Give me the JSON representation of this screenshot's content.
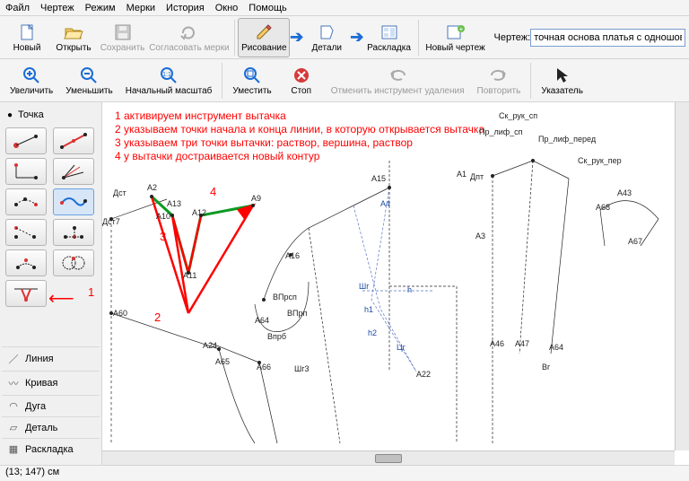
{
  "menu": {
    "file": "Файл",
    "drawing": "Чертеж",
    "mode": "Режим",
    "measures": "Мерки",
    "history": "История",
    "window": "Окно",
    "help": "Помощь"
  },
  "tb1": {
    "new": "Новый",
    "open": "Открыть",
    "save": "Сохранить",
    "sync": "Согласовать мерки",
    "draw": "Рисование",
    "detail": "Детали",
    "layout": "Раскладка",
    "newdraw": "Новый чертеж",
    "drawingLabel": "Чертеж:",
    "drawingValue": "точная основа платья с одношовным рука"
  },
  "tb2": {
    "zoomin": "Увеличить",
    "zoomout": "Уменьшить",
    "zoomreset": "Начальный масштаб",
    "fit": "Уместить",
    "stop": "Стоп",
    "undo": "Отменить инструмент удаления",
    "redo": "Повторить",
    "pointer": "Указатель"
  },
  "side": {
    "point": "Точка",
    "cat": {
      "line": "Линия",
      "curve": "Кривая",
      "arc": "Дуга",
      "detail": "Деталь",
      "layout": "Раскладка"
    },
    "redNum": "1"
  },
  "notes": {
    "l1": "1 активируем инструмент вытачка",
    "l2": "2 указываем точки начала и конца линии, в которую открывается вытачка",
    "l3": "3 указываем три точки вытачки: раствор, вершина, раствор",
    "l4": "4 у вытачки достраивается новый контур"
  },
  "annot": {
    "n2": "2",
    "n3": "3",
    "n4": "4"
  },
  "labels": {
    "Dst": "Дст",
    "Dst7": "Дст7",
    "A2": "А2",
    "A13": "А13",
    "A9": "А9",
    "A10": "А10",
    "A12": "А12",
    "A11": "А11",
    "A60": "А60",
    "A24": "А24",
    "A65": "А65",
    "A66": "А66",
    "A64": "А64",
    "Vprb": "Впрб",
    "Sh3": "Шг3",
    "VPrsp": "ВПрсп",
    "VPrn": "ВПрп",
    "A16": "А16",
    "Shg": "Шг",
    "h1": "h1",
    "h2": "h2",
    "h": "h",
    "Cg": "Цг",
    "A22": "А22",
    "A15": "А15",
    "A4": "А4",
    "A1": "А1",
    "Dpt": "Дпт",
    "A3": "А3",
    "A46": "А46",
    "A47": "А47",
    "A64b": "А64",
    "Vg": "Вг",
    "A43": "А43",
    "A67": "А67",
    "A68": "А68",
    "pr_lif_sp": "Пр_лиф_сп",
    "sk_ruk_sp": "Ск_рук_сп",
    "pr_lif_pered": "Пр_лиф_перед",
    "sk_ruk_per": "Ск_рук_пер"
  },
  "status": "(13; 147) см"
}
